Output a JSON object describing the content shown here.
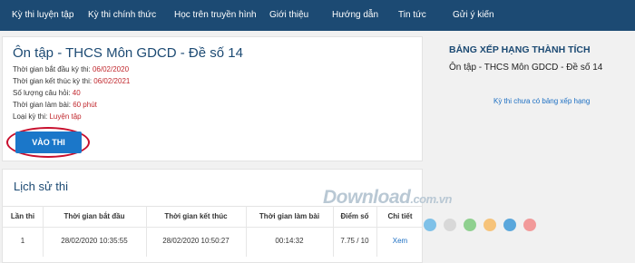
{
  "nav": {
    "items": [
      "Kỳ thi luyện tập",
      "Kỳ thi chính thức",
      "Học trên truyền hình",
      "Giới thiệu",
      "Hướng dẫn",
      "Tin tức",
      "Gửi ý kiến"
    ]
  },
  "exam": {
    "title": "Ôn tập - THCS Môn GDCD - Đề số 14",
    "start_label": "Thời gian bắt đầu kỳ thi:",
    "start_value": "06/02/2020",
    "end_label": "Thời gian kết thúc kỳ thi:",
    "end_value": "06/02/2021",
    "count_label": "Số lượng câu hỏi:",
    "count_value": "40",
    "duration_label": "Thời gian làm bài:",
    "duration_value": "60 phút",
    "type_label": "Loại kỳ thi:",
    "type_value": "Luyện tập",
    "enter_button": "VÀO THI"
  },
  "history": {
    "title": "Lịch sử thi",
    "columns": [
      "Lần thi",
      "Thời gian bắt đầu",
      "Thời gian kết thúc",
      "Thời gian làm bài",
      "Điểm số",
      "Chi tiết"
    ],
    "rows": [
      {
        "attempt": "1",
        "start": "28/02/2020 10:35:55",
        "end": "28/02/2020 10:50:27",
        "duration": "00:14:32",
        "score": "7.75 / 10",
        "detail": "Xem"
      }
    ]
  },
  "ranking": {
    "title": "BẢNG XẾP HẠNG THÀNH TÍCH",
    "exam_name": "Ôn tập - THCS Môn GDCD - Đề số 14",
    "note": "Kỳ thi chưa có bảng xếp hạng"
  },
  "watermark": {
    "text": "Download",
    "suffix": ".com.vn",
    "dot_colors": [
      "#7fc1e8",
      "#d8d8d8",
      "#8fd08f",
      "#f6c37a",
      "#5aa7dc",
      "#f29a9a"
    ]
  },
  "colors": {
    "nav_bg": "#1c4a73",
    "accent_blue": "#1b77c9",
    "value_red": "#c0272d",
    "highlight_ring": "#c8102e"
  }
}
